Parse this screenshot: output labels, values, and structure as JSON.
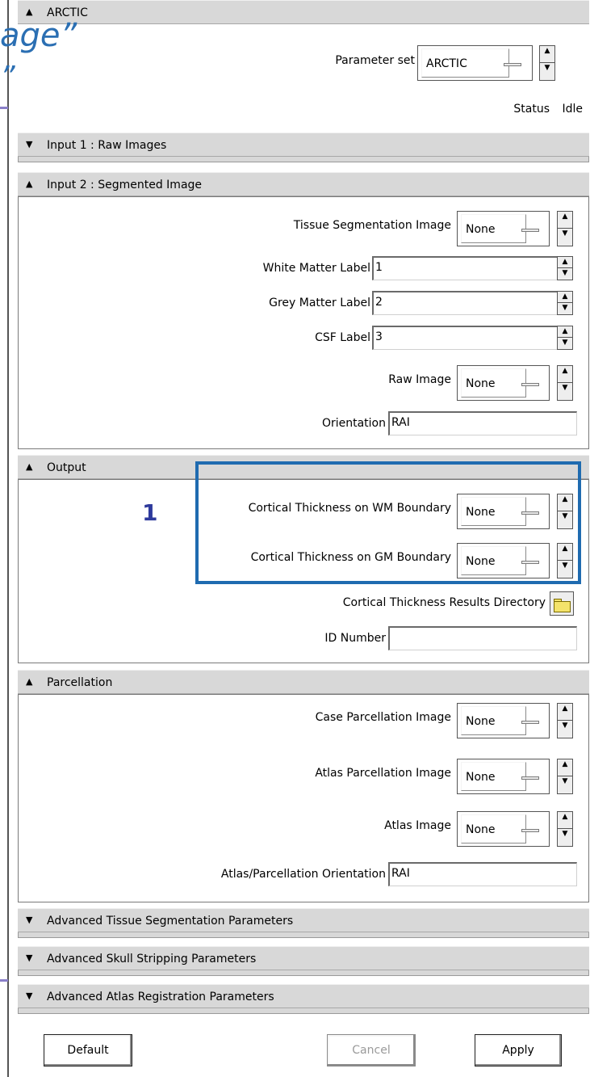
{
  "window": {
    "title": "ARCTIC"
  },
  "slide": {
    "text_top": "age”",
    "text_second": "”"
  },
  "parameter_set": {
    "label": "Parameter set",
    "value": "ARCTIC"
  },
  "status": {
    "label": "Status",
    "value": "Idle"
  },
  "sections": {
    "input1": {
      "title": "Input 1 : Raw Images"
    },
    "input2": {
      "title": "Input 2 : Segmented Image",
      "tissue_seg": {
        "label": "Tissue Segmentation Image",
        "value": "None"
      },
      "wm_label": {
        "label": "White Matter Label",
        "value": "1"
      },
      "gm_label": {
        "label": "Grey Matter Label",
        "value": "2"
      },
      "csf_label": {
        "label": "CSF Label",
        "value": "3"
      },
      "raw_image": {
        "label": "Raw Image",
        "value": "None"
      },
      "orientation": {
        "label": "Orientation",
        "value": "RAI"
      }
    },
    "output": {
      "title": "Output",
      "callout": "1",
      "wm_boundary": {
        "label": "Cortical Thickness on WM Boundary",
        "value": "None"
      },
      "gm_boundary": {
        "label": "Cortical Thickness on GM Boundary",
        "value": "None"
      },
      "results_dir": {
        "label": "Cortical Thickness Results Directory"
      },
      "id_number": {
        "label": "ID Number",
        "value": ""
      }
    },
    "parcellation": {
      "title": "Parcellation",
      "case_parc": {
        "label": "Case Parcellation Image",
        "value": "None"
      },
      "atlas_parc": {
        "label": "Atlas Parcellation Image",
        "value": "None"
      },
      "atlas_image": {
        "label": "Atlas Image",
        "value": "None"
      },
      "atlas_orientation": {
        "label": "Atlas/Parcellation Orientation",
        "value": "RAI"
      }
    },
    "adv_tissue": {
      "title": "Advanced Tissue Segmentation Parameters"
    },
    "adv_skull": {
      "title": "Advanced Skull Stripping Parameters"
    },
    "adv_atlas": {
      "title": "Advanced Atlas Registration Parameters"
    }
  },
  "buttons": {
    "default": "Default",
    "cancel": "Cancel",
    "apply": "Apply"
  },
  "icons": {
    "expanded": "triangle-up-icon",
    "collapsed": "triangle-down-icon",
    "folder": "folder-icon"
  },
  "colors": {
    "highlight": "#1f6bb0",
    "callout": "#2e3a9c",
    "slide_text": "#2b6fb3"
  }
}
